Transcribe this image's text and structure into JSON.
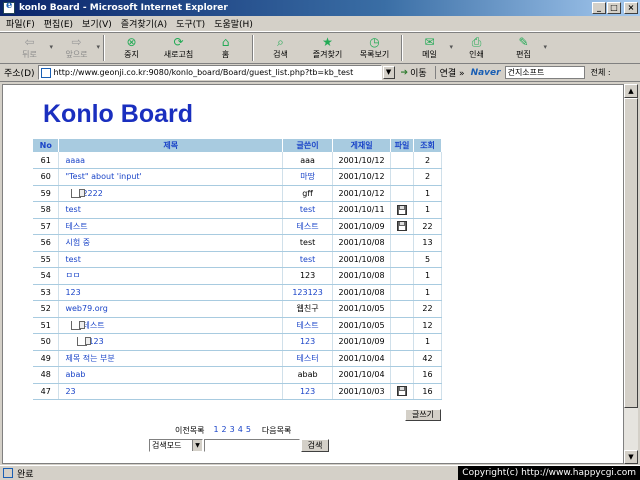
{
  "window": {
    "title": "konlo Board - Microsoft Internet Explorer",
    "controls": [
      "_",
      "□",
      "×"
    ]
  },
  "menu": [
    "파일(F)",
    "편집(E)",
    "보기(V)",
    "즐겨찾기(A)",
    "도구(T)",
    "도움말(H)"
  ],
  "toolbar": [
    {
      "label": "뒤로",
      "icon": "back-arrow-icon",
      "glyph": "⇦",
      "disabled": true
    },
    {
      "label": "앞으로",
      "icon": "forward-arrow-icon",
      "glyph": "⇨",
      "disabled": true
    },
    {
      "label": "중지",
      "icon": "stop-icon",
      "glyph": "⊗",
      "disabled": false
    },
    {
      "label": "새로고침",
      "icon": "refresh-icon",
      "glyph": "⟳",
      "disabled": false
    },
    {
      "label": "홈",
      "icon": "home-icon",
      "glyph": "⌂",
      "disabled": false
    },
    {
      "label": "검색",
      "icon": "search-icon",
      "glyph": "⌕",
      "disabled": false
    },
    {
      "label": "즐겨찾기",
      "icon": "favorites-icon",
      "glyph": "★",
      "disabled": false
    },
    {
      "label": "목록보기",
      "icon": "history-icon",
      "glyph": "◷",
      "disabled": false
    },
    {
      "label": "메일",
      "icon": "mail-icon",
      "glyph": "✉",
      "disabled": false
    },
    {
      "label": "인쇄",
      "icon": "print-icon",
      "glyph": "⎙",
      "disabled": false
    },
    {
      "label": "편집",
      "icon": "edit-icon",
      "glyph": "✎",
      "disabled": false
    }
  ],
  "address": {
    "label": "주소(D)",
    "url": "http://www.geonji.co.kr:9080/konlo_board/Board/guest_list.php?tb=kb_test",
    "go_label": "이동",
    "links_label": "연결 »",
    "naver_label": "Naver",
    "naver_search": "건지소프트",
    "all_label": "전체 :"
  },
  "board": {
    "title": "Konlo Board",
    "headers": [
      "No",
      "제목",
      "글쓴이",
      "게재일",
      "파일",
      "조회"
    ],
    "rows": [
      {
        "no": "61",
        "subject": "aaaa",
        "reply": 0,
        "author": "aaa",
        "author_link": false,
        "date": "2001/10/12",
        "file": false,
        "views": "2"
      },
      {
        "no": "60",
        "subject": "\"Test\" about 'input'",
        "reply": 0,
        "author": "마땅",
        "author_link": true,
        "date": "2001/10/12",
        "file": false,
        "views": "2"
      },
      {
        "no": "59",
        "subject": "2222",
        "reply": 1,
        "author": "gff",
        "author_link": false,
        "date": "2001/10/12",
        "file": false,
        "views": "1"
      },
      {
        "no": "58",
        "subject": "test",
        "reply": 0,
        "author": "test",
        "author_link": true,
        "date": "2001/10/11",
        "file": true,
        "views": "1"
      },
      {
        "no": "57",
        "subject": "테스트",
        "reply": 0,
        "author": "테스트",
        "author_link": true,
        "date": "2001/10/09",
        "file": true,
        "views": "22"
      },
      {
        "no": "56",
        "subject": "시험 중",
        "reply": 0,
        "author": "test",
        "author_link": false,
        "date": "2001/10/08",
        "file": false,
        "views": "13"
      },
      {
        "no": "55",
        "subject": "test",
        "reply": 0,
        "author": "test",
        "author_link": true,
        "date": "2001/10/08",
        "file": false,
        "views": "5"
      },
      {
        "no": "54",
        "subject": "ㅁㅁ",
        "reply": 0,
        "author": "123",
        "author_link": false,
        "date": "2001/10/08",
        "file": false,
        "views": "1"
      },
      {
        "no": "53",
        "subject": "123",
        "reply": 0,
        "author": "123123",
        "author_link": true,
        "date": "2001/10/08",
        "file": false,
        "views": "1"
      },
      {
        "no": "52",
        "subject": "web79.org",
        "reply": 0,
        "author": "웹친구",
        "author_link": false,
        "date": "2001/10/05",
        "file": false,
        "views": "22"
      },
      {
        "no": "51",
        "subject": "테스트",
        "reply": 1,
        "author": "테스트",
        "author_link": true,
        "date": "2001/10/05",
        "file": false,
        "views": "12"
      },
      {
        "no": "50",
        "subject": "123",
        "reply": 2,
        "author": "123",
        "author_link": true,
        "date": "2001/10/09",
        "file": false,
        "views": "1"
      },
      {
        "no": "49",
        "subject": "제목 적는 부분",
        "reply": 0,
        "author": "테스터",
        "author_link": true,
        "date": "2001/10/04",
        "file": false,
        "views": "42"
      },
      {
        "no": "48",
        "subject": "abab",
        "reply": 0,
        "author": "abab",
        "author_link": false,
        "date": "2001/10/04",
        "file": false,
        "views": "16"
      },
      {
        "no": "47",
        "subject": "23",
        "reply": 0,
        "author": "123",
        "author_link": true,
        "date": "2001/10/03",
        "file": true,
        "views": "16"
      }
    ],
    "write_label": "글쓰기",
    "pager": {
      "prev": "이전목록",
      "pages": [
        "1",
        "2",
        "3",
        "4",
        "5"
      ],
      "next": "다음목록"
    },
    "search": {
      "mode": "검색모드",
      "button": "검색"
    }
  },
  "status": {
    "text": "완료",
    "copyright": "Copyright(c) http://www.happycgi.com"
  }
}
